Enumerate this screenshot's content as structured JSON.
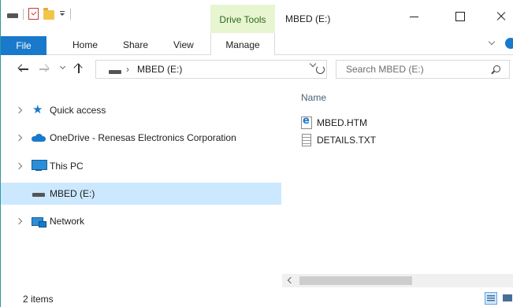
{
  "titlebar": {
    "context_tab": "Drive Tools",
    "title": "MBED (E:)"
  },
  "ribbon": {
    "tabs": {
      "file": "File",
      "home": "Home",
      "share": "Share",
      "view": "View",
      "manage": "Manage"
    }
  },
  "address": {
    "separator": "›",
    "path": "MBED (E:)"
  },
  "search": {
    "placeholder": "Search MBED (E:)"
  },
  "navpane": {
    "items": [
      {
        "label": "Quick access",
        "icon": "star-icon"
      },
      {
        "label": "OneDrive - Renesas Electronics Corporation",
        "icon": "cloud-icon"
      },
      {
        "label": "This PC",
        "icon": "pc-icon"
      },
      {
        "label": "MBED (E:)",
        "icon": "drive-icon",
        "selected": true
      },
      {
        "label": "Network",
        "icon": "network-icon"
      }
    ]
  },
  "content": {
    "column_name": "Name",
    "files": [
      {
        "name": "MBED.HTM",
        "icon": "htm-file-icon"
      },
      {
        "name": "DETAILS.TXT",
        "icon": "txt-file-icon"
      }
    ]
  },
  "status": {
    "item_count": "2 items"
  },
  "colors": {
    "accent": "#1979ca",
    "selected_bg": "#cce8ff",
    "context_tab_bg": "#e7f5d0",
    "border_teal": "#2b9aa0"
  }
}
